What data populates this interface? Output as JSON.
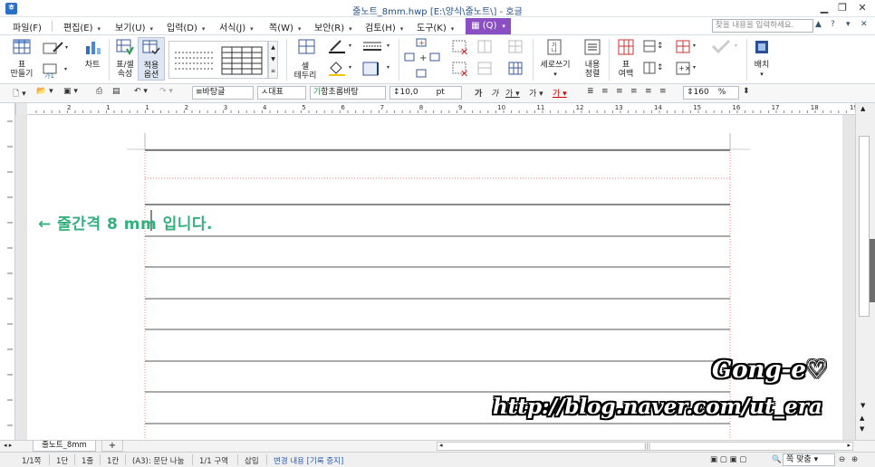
{
  "window": {
    "title": "줄노트_8mm.hwp [E:\\양식\\줄노트\\] - 호글",
    "app_icon": "hwp-app-icon",
    "controls": [
      "minimize",
      "restore",
      "close"
    ]
  },
  "menubar": {
    "items": [
      {
        "label": "파일(F)",
        "arrow": "▾"
      },
      {
        "label": "편집(E)",
        "arrow": "▾"
      },
      {
        "label": "보기(U)",
        "arrow": "▾"
      },
      {
        "label": "입력(D)",
        "arrow": "▾"
      },
      {
        "label": "서식(J)",
        "arrow": "▾"
      },
      {
        "label": "쪽(W)",
        "arrow": "▾"
      },
      {
        "label": "보안(R)",
        "arrow": "▾"
      },
      {
        "label": "검토(H)",
        "arrow": "▾"
      },
      {
        "label": "도구(K)",
        "arrow": "▾"
      }
    ],
    "table_menu": "(Q)",
    "search_placeholder": "찾을 내용을 입력하세요."
  },
  "ribbon": {
    "make_table": "표\n만들기",
    "chart": "차트",
    "table_cell_props": "표/셀\n속성",
    "apply_options": "적용\n옵션",
    "cell_border": "셀\n테두리",
    "vertical_write": "세로쓰기",
    "content_align": "내용\n정렬",
    "table_margin": "표\n여백",
    "arrange": "배치"
  },
  "toolbar": {
    "style": "바탕글",
    "lang": "대표",
    "font": "함초롬바탕",
    "size": "10,0",
    "unit": "pt",
    "zoom": "160",
    "zoom_unit": "%"
  },
  "ruler": {
    "numbers": [
      "2",
      "1",
      "1",
      "2",
      "3",
      "4",
      "5",
      "6",
      "7",
      "8",
      "9",
      "10",
      "11",
      "12",
      "13",
      "14",
      "15",
      "16",
      "17",
      "18",
      "19"
    ]
  },
  "document": {
    "annotation": "← 줄간격 8 mm 입니다."
  },
  "tabs": {
    "doc_tab": "줄노트_8mm",
    "add_tab": "+"
  },
  "statusbar": {
    "page": "1/1쪽",
    "column": "1단",
    "line": "1줄",
    "col": "1칸",
    "break": "(A3): 문단 나눔",
    "section": "1/1 구역",
    "insert": "삽입",
    "track": "변경 내용 [기록 중지]",
    "zoom_mode": "쪽 맞춤"
  },
  "watermark": {
    "name": "Gong-e♡",
    "url": "http://blog.naver.com/ut_era"
  },
  "colors": {
    "accent": "#8a4fc2",
    "annotation": "#33b07e",
    "page_border": "#ff6b6b",
    "rule_line": "#555555",
    "title_text": "#2a4f8a"
  }
}
